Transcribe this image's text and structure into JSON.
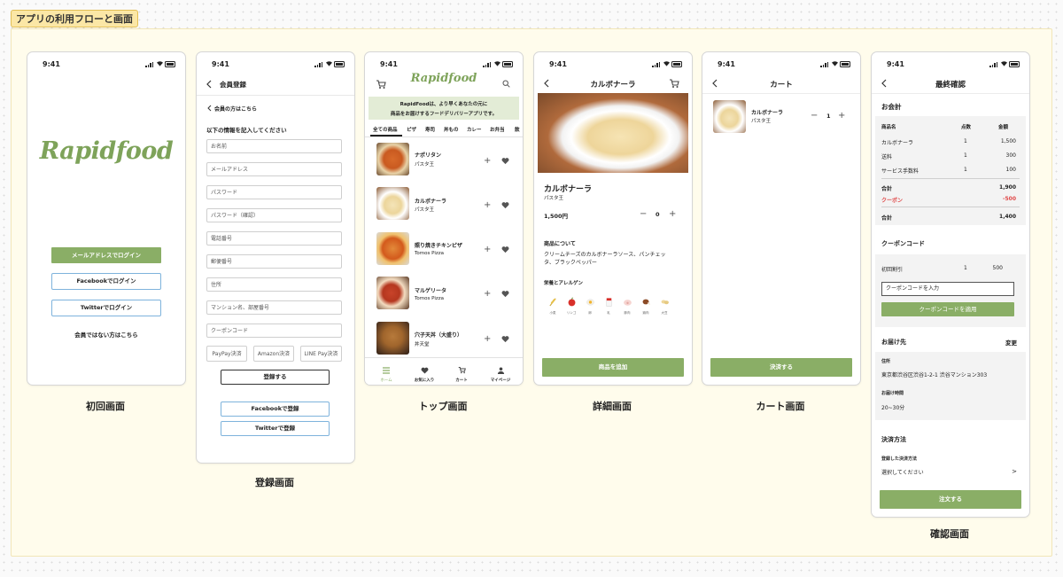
{
  "board": {
    "label": "アプリの利用フローと画面"
  },
  "status_time": "9:41",
  "colors": {
    "accent": "#8aae66",
    "brand_text": "#7ea35a",
    "outline_blue": "#7eb3dc",
    "coupon_red": "#e04848",
    "section_bg": "#fffcec"
  },
  "screen1": {
    "logo": "Rapidfood",
    "email_login": "メールアドレスでログイン",
    "facebook_login": "Facebookでログイン",
    "twitter_login": "Twitterでログイン",
    "non_member": "会員ではない方はこちら",
    "caption": "初回画面"
  },
  "screen2": {
    "title": "会員登録",
    "member_link": "会員の方はこちら",
    "instruction": "以下の情報を記入してください",
    "fields": [
      "お名前",
      "メールアドレス",
      "パスワード",
      "パスワード（確認）",
      "電話番号",
      "郵便番号",
      "住所",
      "マンション名、部屋番号",
      "クーポンコード"
    ],
    "payments": [
      "PayPay決済",
      "Amazon決済",
      "LINE Pay決済"
    ],
    "register": "登録する",
    "facebook_register": "Facebookで登録",
    "twitter_register": "Twitterで登録",
    "caption": "登録画面"
  },
  "screen3": {
    "logo": "Rapidfood",
    "banner_line1": "RapidFoodは、より早くあなたの元に",
    "banner_line2": "商品をお届けするフードデリバリーアプリです。",
    "categories": [
      "全ての商品",
      "ピザ",
      "寿司",
      "丼もの",
      "カレー",
      "お弁当",
      "飲"
    ],
    "items": [
      {
        "name": "ナポリタン",
        "shop": "パスタ王"
      },
      {
        "name": "カルボナーラ",
        "shop": "パスタ王"
      },
      {
        "name": "照り焼きチキンピザ",
        "shop": "Tomos Pizza"
      },
      {
        "name": "マルゲリータ",
        "shop": "Tomos Pizza"
      },
      {
        "name": "穴子天丼（大盛り）",
        "shop": "丼天堂"
      }
    ],
    "tabbar": [
      "ホーム",
      "お気に入り",
      "カート",
      "マイページ"
    ],
    "caption": "トップ画面"
  },
  "screen4": {
    "title": "カルボナーラ",
    "name": "カルボナーラ",
    "shop": "パスタ王",
    "price": "1,500円",
    "quantity": "0",
    "about_heading": "商品について",
    "about_text": "クリームチーズのカルボナーラソース、パンチェッタ、ブラックペッパー",
    "allergy_heading": "栄養とアレルゲン",
    "allergens": [
      {
        "icon": "wheat-icon",
        "label": "小麦"
      },
      {
        "icon": "apple-icon",
        "label": "リンゴ"
      },
      {
        "icon": "egg-icon",
        "label": "卵"
      },
      {
        "icon": "milk-icon",
        "label": "乳"
      },
      {
        "icon": "pork-icon",
        "label": "豚肉"
      },
      {
        "icon": "chicken-icon",
        "label": "鶏肉"
      },
      {
        "icon": "soy-icon",
        "label": "大豆"
      }
    ],
    "add_button": "商品を追加",
    "caption": "詳細画面"
  },
  "screen5": {
    "title": "カート",
    "item_name": "カルボナーラ",
    "item_shop": "パスタ王",
    "quantity": "1",
    "checkout": "決済する",
    "caption": "カート画面"
  },
  "screen6": {
    "title": "最終確認",
    "bill_heading": "お会計",
    "col_headers": [
      "商品名",
      "点数",
      "金額"
    ],
    "rows": [
      {
        "name": "カルボナーラ",
        "qty": "1",
        "amount": "1,500"
      },
      {
        "name": "送料",
        "qty": "1",
        "amount": "300"
      },
      {
        "name": "サービス手数料",
        "qty": "1",
        "amount": "100"
      }
    ],
    "subtotal_label": "合計",
    "subtotal": "1,900",
    "coupon_label": "クーポン",
    "coupon_amount": "-500",
    "total_label": "合計",
    "total": "1,400",
    "coupon_heading": "クーポンコード",
    "coupon_name": "初回割引",
    "coupon_qty": "1",
    "coupon_value": "500",
    "coupon_placeholder": "クーポンコードを入力",
    "coupon_apply": "クーポンコードを適用",
    "delivery_heading": "お届け先",
    "change": "変更",
    "address_label": "住所",
    "address": "東京都渋谷区渋谷1-2-1 渋谷マンション303",
    "time_label": "お届け時間",
    "time": "20~30分",
    "payment_heading": "決済方法",
    "payment_label": "登録した決済方法",
    "payment_select": "選択してください",
    "chevron": ">",
    "order": "注文する",
    "caption": "確認画面"
  }
}
